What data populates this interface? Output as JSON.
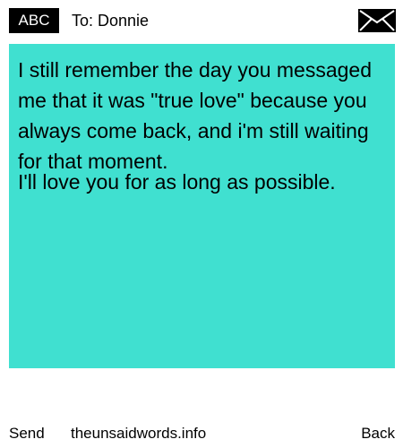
{
  "header": {
    "badge": "ABC",
    "recipient": "To: Donnie",
    "mail_icon": "envelope-icon"
  },
  "message": {
    "background_color": "#40e0d0",
    "paragraphs": [
      "I still remember the day you messaged me that it was \"true love\" because you always come back, and i'm still waiting for that moment.",
      "I'll love you for as long as possible."
    ]
  },
  "footer": {
    "send_label": "Send",
    "site": "theunsaidwords.info",
    "back_label": "Back"
  }
}
